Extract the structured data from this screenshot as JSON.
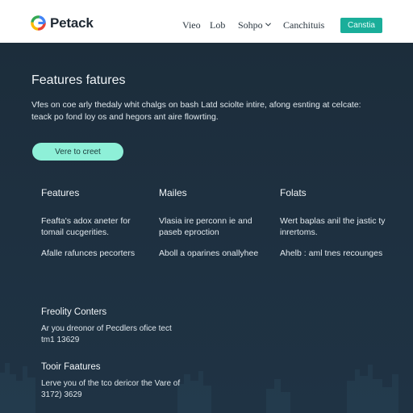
{
  "nav": {
    "brand": "Petack",
    "links": [
      "Vieo",
      "Lob",
      "Sohpo",
      "Canchituis"
    ],
    "cta": "Canstia"
  },
  "hero": {
    "title": "Features fatures",
    "description": "Vfes on coe arly thedaly whit chalgs on bash Latd sciolte intire, afong esnting at celcate: teack po fond loy os and hegors ant aire flowrting.",
    "button": "Vere to creet"
  },
  "columns": [
    {
      "heading": "Features",
      "text1": "Feafta's adox aneter for tomail cucgerities.",
      "text2": "Afalle rafunces pecorters"
    },
    {
      "heading": "Mailes",
      "text1": "Vlasia ire perconn ie and paseb eproction",
      "text2": "Aboll a oparines onallyhee"
    },
    {
      "heading": "Folats",
      "text1": "Wert baplas anil the jastic ty inrertoms.",
      "text2": "Ahelb : aml tnes recounges"
    }
  ],
  "sections": [
    {
      "heading": "Freolity Conters",
      "text": "Ar you dreonor of Pecdlers ofice tect tm1 13629"
    },
    {
      "heading": "Tooir Faatures",
      "text": "Lerve you of the tco dericor the Vare of 3172) 3629"
    }
  ],
  "colors": {
    "accent": "#1aae9a",
    "hero_button": "#8ef0d8",
    "background": "#1b2c3a"
  }
}
